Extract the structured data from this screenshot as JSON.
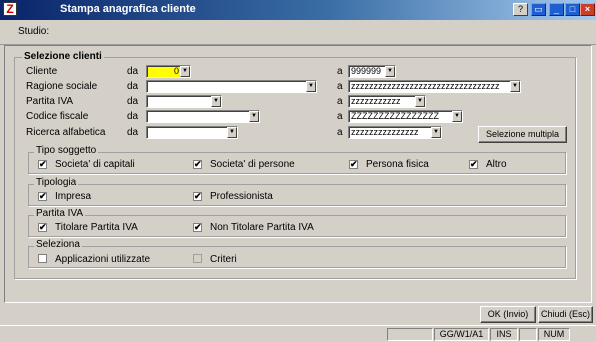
{
  "window": {
    "title": "Stampa anagrafica cliente",
    "app_icon": "app-logo-icon",
    "controls": {
      "help": "?",
      "restore": "▭",
      "minimize": "_",
      "maximize": "□",
      "close": "×"
    }
  },
  "studio": {
    "label": "Studio:"
  },
  "selezione_clienti": {
    "title": "Selezione clienti",
    "da": "da",
    "a": "a",
    "rows": [
      {
        "label": "Cliente",
        "from": "0",
        "to": "999999"
      },
      {
        "label": "Ragione sociale",
        "from": "",
        "to": "zzzzzzzzzzzzzzzzzzzzzzzzzzzzzzzzz"
      },
      {
        "label": "Partita IVA",
        "from": "",
        "to": "zzzzzzzzzzz"
      },
      {
        "label": "Codice fiscale",
        "from": "",
        "to": "ZZZZZZZZZZZZZZZZ"
      },
      {
        "label": "Ricerca alfabetica",
        "from": "",
        "to": "zzzzzzzzzzzzzzz"
      }
    ],
    "selezione_multipla": "Selezione multipla"
  },
  "tipo_soggetto": {
    "title": "Tipo soggetto",
    "items": [
      {
        "label": "Societa' di capitali",
        "checked": true
      },
      {
        "label": "Societa' di persone",
        "checked": true
      },
      {
        "label": "Persona fisica",
        "checked": true
      },
      {
        "label": "Altro",
        "checked": true
      }
    ]
  },
  "tipologia": {
    "title": "Tipologia",
    "items": [
      {
        "label": "Impresa",
        "checked": true
      },
      {
        "label": "Professionista",
        "checked": true
      }
    ]
  },
  "partita_iva": {
    "title": "Partita IVA",
    "items": [
      {
        "label": "Titolare Partita IVA",
        "checked": true
      },
      {
        "label": "Non Titolare Partita IVA",
        "checked": true
      }
    ]
  },
  "seleziona": {
    "title": "Seleziona",
    "items": [
      {
        "label": "Applicazioni utilizzate",
        "checked": false
      },
      {
        "label": "Criteri",
        "checked": false
      }
    ]
  },
  "buttons": {
    "ok": "OK (Invio)",
    "chiudi": "Chiudi (Esc)"
  },
  "status": {
    "cell1": "",
    "cell2": "GG/W1/A1",
    "cell3": "INS",
    "cell4": "",
    "cell5": "NUM"
  },
  "check_mark": "✔"
}
